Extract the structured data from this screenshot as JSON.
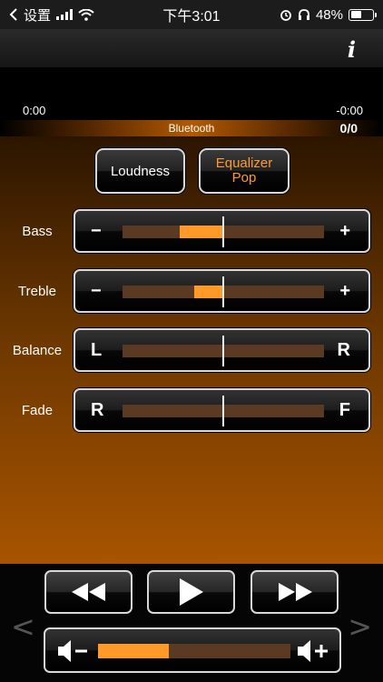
{
  "status_bar": {
    "carrier": "设置",
    "time": "下午3:01",
    "battery_percent": "48%",
    "battery_level": 0.48
  },
  "header": {
    "info_label": "i"
  },
  "playback": {
    "elapsed": "0:00",
    "remaining": "-0:00",
    "source": "Bluetooth",
    "track_count": "0/0"
  },
  "buttons": {
    "loudness": "Loudness",
    "equalizer_title": "Equalizer",
    "equalizer_preset": "Pop"
  },
  "sliders": [
    {
      "label": "Bass",
      "left_end": "−",
      "right_end": "+",
      "value": -0.43
    },
    {
      "label": "Treble",
      "left_end": "−",
      "right_end": "+",
      "value": -0.29
    },
    {
      "label": "Balance",
      "left_end": "L",
      "right_end": "R",
      "value": 0
    },
    {
      "label": "Fade",
      "left_end": "R",
      "right_end": "F",
      "value": 0
    }
  ],
  "volume": {
    "level": 0.37
  },
  "navigation": {
    "prev_symbol": "<",
    "next_symbol": ">"
  },
  "colors": {
    "accent": "#ff9a2a",
    "track": "#5a3a22"
  }
}
